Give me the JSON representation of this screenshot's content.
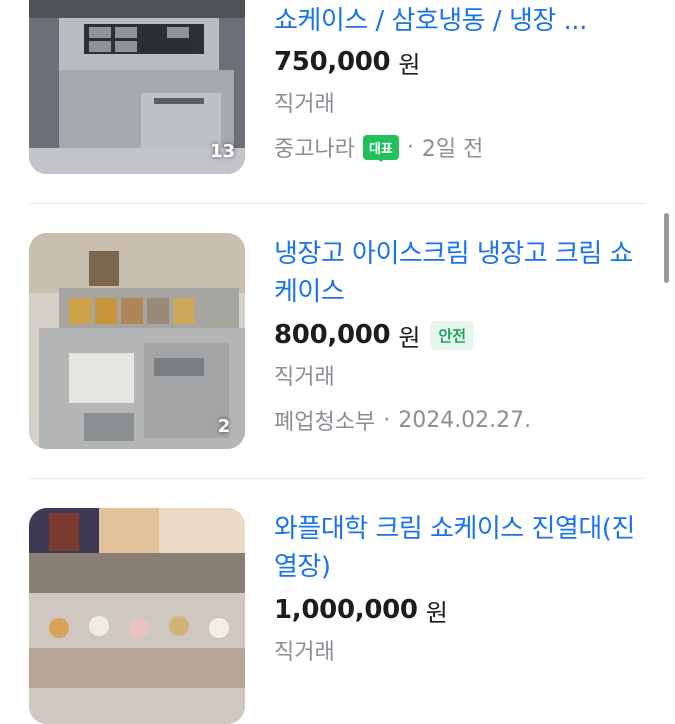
{
  "listings": [
    {
      "title": "쇼케이스 / 삼호냉동 / 냉장 ...",
      "price": "750,000",
      "currency": "원",
      "trade_type": "직거래",
      "source": "중고나라",
      "source_badge": "대표",
      "date": "2일 전",
      "image_count": "13",
      "image_desc_icon": "display-case-thumbnail"
    },
    {
      "title": "냉장고 아이스크림 냉장고 크림 쇼케이스",
      "price": "800,000",
      "currency": "원",
      "safe_badge": "안전",
      "trade_type": "직거래",
      "source": "폐업청소부",
      "date": "2024.02.27.",
      "image_count": "2"
    },
    {
      "title": "와플대학 크림 쇼케이스 진열대(진열장)",
      "price": "1,000,000",
      "currency": "원",
      "trade_type": "직거래"
    }
  ],
  "separator": "·",
  "colors": {
    "title_blue": "#1a73e8",
    "meta_gray": "#8a8f96",
    "badge_green": "#21c05a",
    "safe_green": "#1aa260"
  }
}
